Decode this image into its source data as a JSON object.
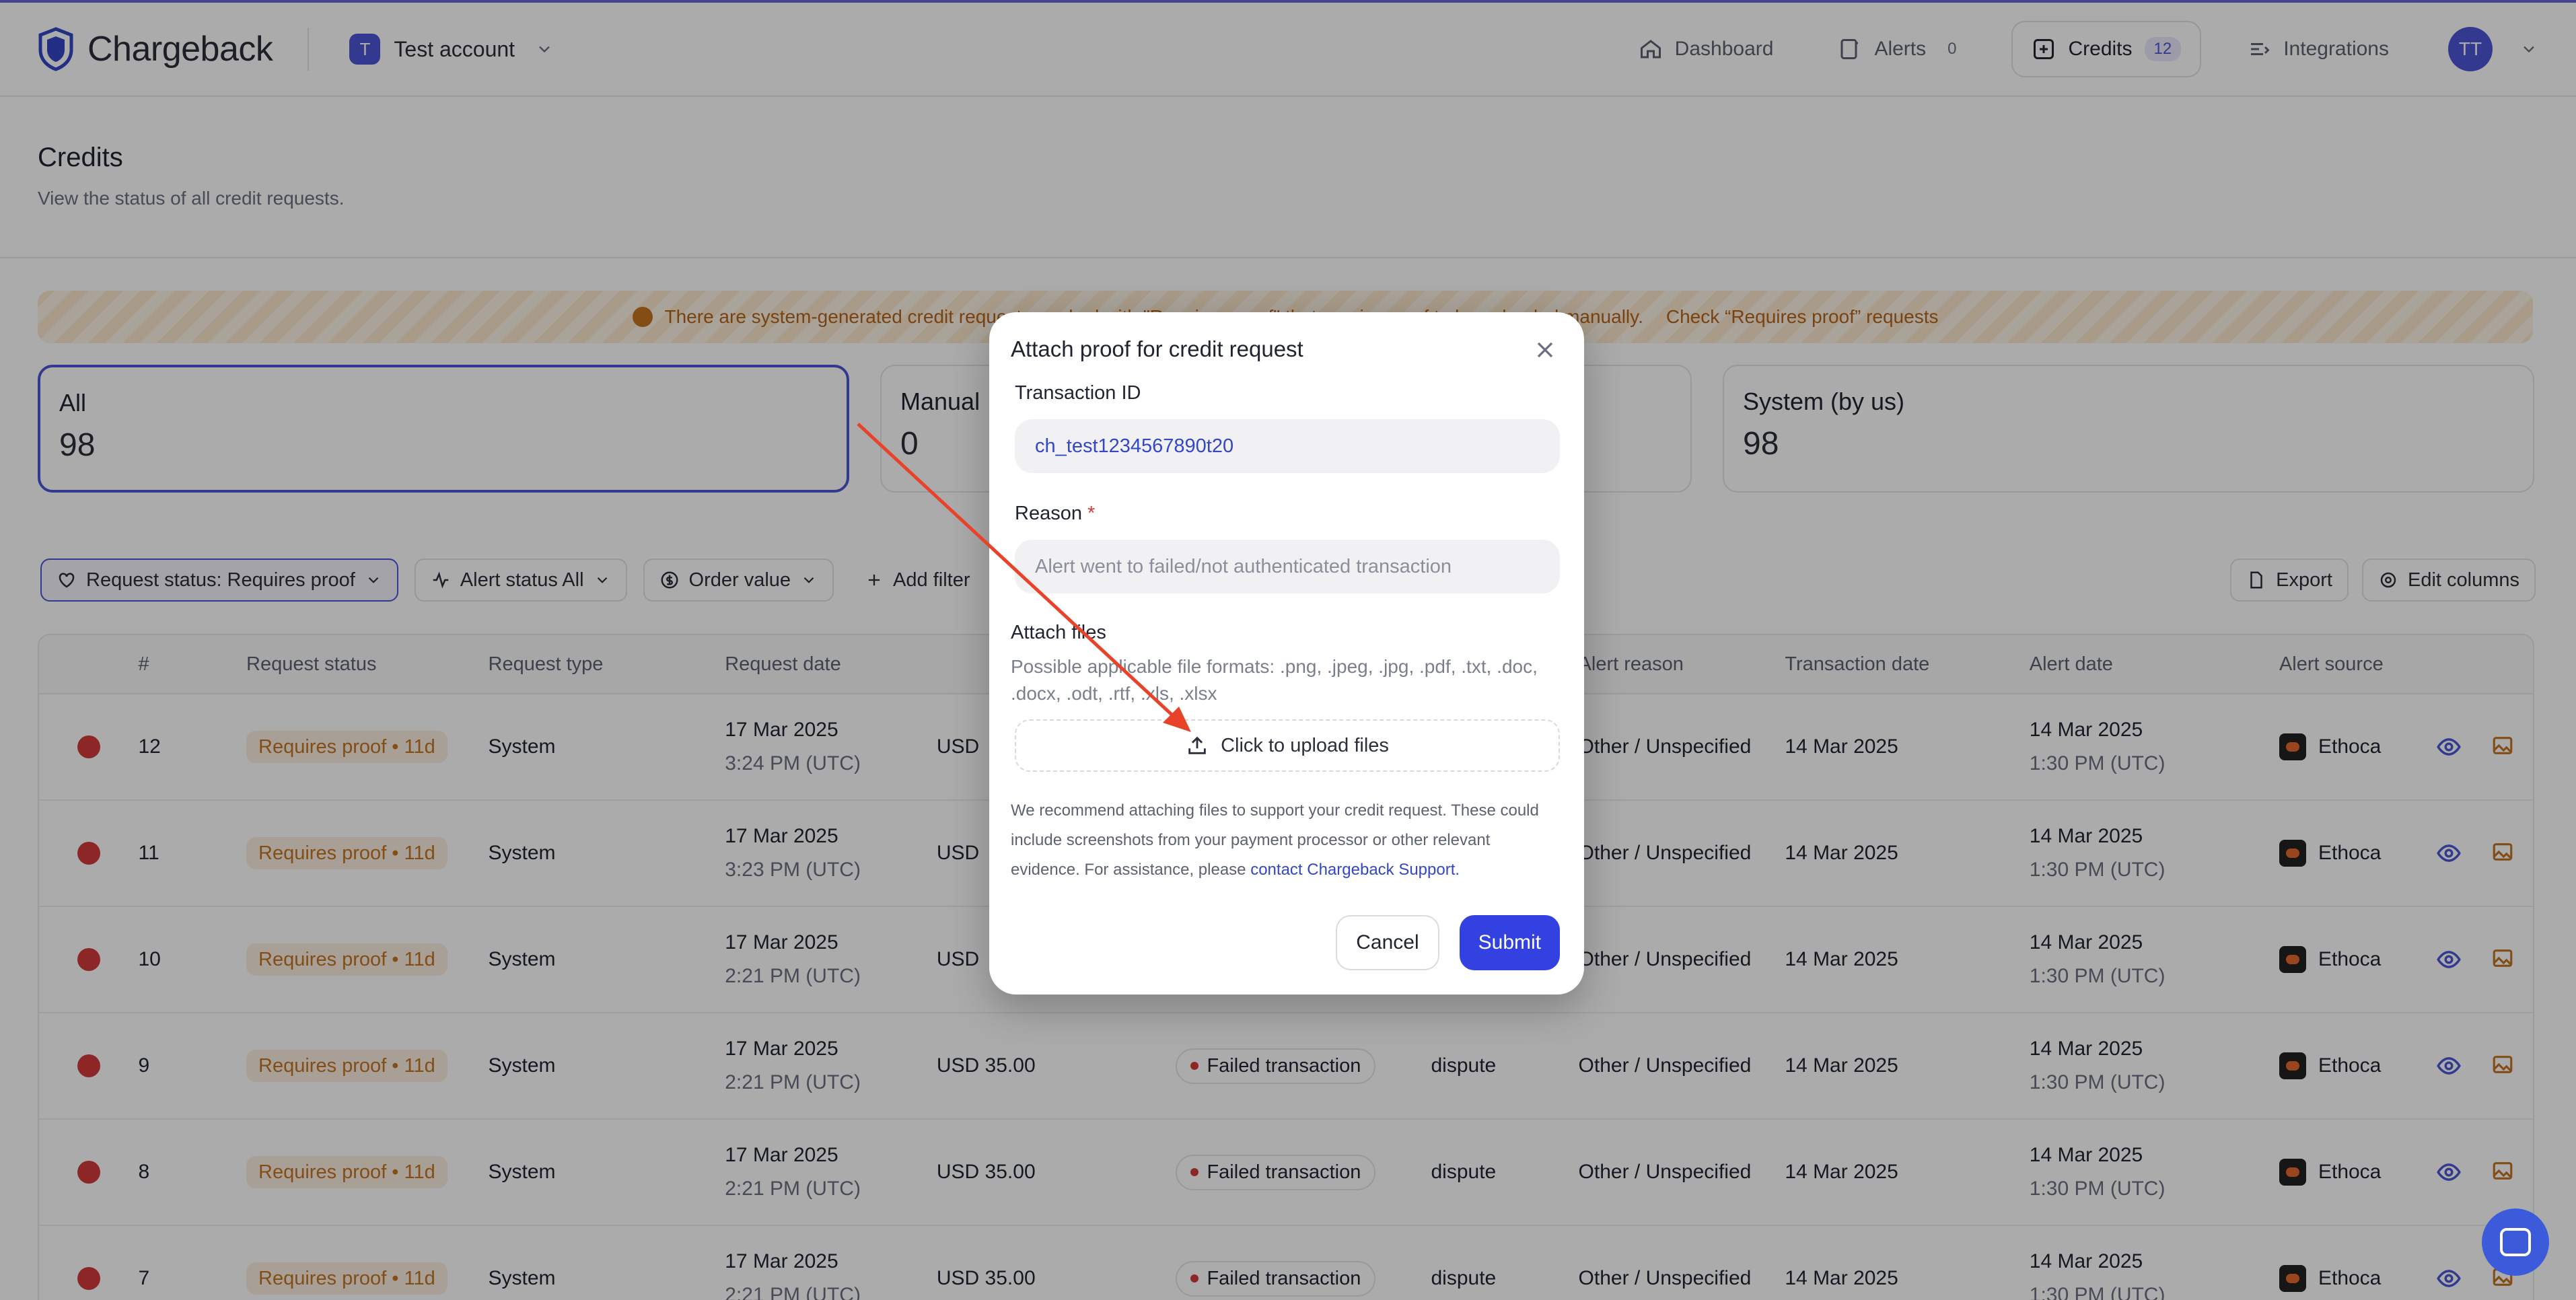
{
  "app": {
    "brand": "Chargeback",
    "account_initial": "T",
    "account_name": "Test account",
    "avatar_initials": "TT"
  },
  "nav": {
    "dashboard": "Dashboard",
    "alerts": "Alerts",
    "alerts_count": "0",
    "credits": "Credits",
    "credits_count": "12",
    "integrations": "Integrations"
  },
  "header": {
    "title": "Credits",
    "subtitle": "View the status of all credit requests."
  },
  "banner": {
    "text": "There are system-generated credit requests marked with \"Requires proof\" that require proof to be uploaded manually.",
    "link": "Check “Requires proof” requests"
  },
  "cards": [
    {
      "label": "All",
      "value": "98"
    },
    {
      "label": "Manual",
      "value": "0"
    },
    {
      "label": "System (by us)",
      "value": "98"
    }
  ],
  "filters": {
    "request_status": "Request status: Requires proof",
    "alert_status": "Alert status All",
    "order_value": "Order value",
    "add_filter": "Add filter",
    "export": "Export",
    "edit_columns": "Edit columns"
  },
  "table": {
    "headers": {
      "num": "#",
      "request_status": "Request status",
      "request_type": "Request type",
      "request_date": "Request date",
      "alert_reason": "Alert reason",
      "transaction_date": "Transaction date",
      "alert_date": "Alert date",
      "alert_source": "Alert source"
    },
    "rows": [
      {
        "num": "12",
        "status": "Requires proof • 11d",
        "type": "System",
        "date": "17 Mar 2025",
        "time": "3:24 PM (UTC)",
        "amount": "USD",
        "alert_status": "",
        "kind": "",
        "reason": "Other / Unspecified",
        "tx_date": "14 Mar 2025",
        "alert_date": "14 Mar 2025",
        "alert_time": "1:30 PM (UTC)",
        "source": "Ethoca"
      },
      {
        "num": "11",
        "status": "Requires proof • 11d",
        "type": "System",
        "date": "17 Mar 2025",
        "time": "3:23 PM (UTC)",
        "amount": "USD",
        "alert_status": "",
        "kind": "",
        "reason": "Other / Unspecified",
        "tx_date": "14 Mar 2025",
        "alert_date": "14 Mar 2025",
        "alert_time": "1:30 PM (UTC)",
        "source": "Ethoca"
      },
      {
        "num": "10",
        "status": "Requires proof • 11d",
        "type": "System",
        "date": "17 Mar 2025",
        "time": "2:21 PM (UTC)",
        "amount": "USD",
        "alert_status": "",
        "kind": "",
        "reason": "Other / Unspecified",
        "tx_date": "14 Mar 2025",
        "alert_date": "14 Mar 2025",
        "alert_time": "1:30 PM (UTC)",
        "source": "Ethoca"
      },
      {
        "num": "9",
        "status": "Requires proof • 11d",
        "type": "System",
        "date": "17 Mar 2025",
        "time": "2:21 PM (UTC)",
        "amount": "USD 35.00",
        "alert_status": "Failed transaction",
        "kind": "dispute",
        "reason": "Other / Unspecified",
        "tx_date": "14 Mar 2025",
        "alert_date": "14 Mar 2025",
        "alert_time": "1:30 PM (UTC)",
        "source": "Ethoca"
      },
      {
        "num": "8",
        "status": "Requires proof • 11d",
        "type": "System",
        "date": "17 Mar 2025",
        "time": "2:21 PM (UTC)",
        "amount": "USD 35.00",
        "alert_status": "Failed transaction",
        "kind": "dispute",
        "reason": "Other / Unspecified",
        "tx_date": "14 Mar 2025",
        "alert_date": "14 Mar 2025",
        "alert_time": "1:30 PM (UTC)",
        "source": "Ethoca"
      },
      {
        "num": "7",
        "status": "Requires proof • 11d",
        "type": "System",
        "date": "17 Mar 2025",
        "time": "2:21 PM (UTC)",
        "amount": "USD 35.00",
        "alert_status": "Failed transaction",
        "kind": "dispute",
        "reason": "Other / Unspecified",
        "tx_date": "14 Mar 2025",
        "alert_date": "14 Mar 2025",
        "alert_time": "1:30 PM (UTC)",
        "source": "Ethoca"
      }
    ]
  },
  "modal": {
    "title": "Attach proof for credit request",
    "transaction_label": "Transaction ID",
    "transaction_value": "ch_test1234567890t20",
    "reason_label": "Reason",
    "reason_required": "*",
    "reason_placeholder": "Alert went to failed/not authenticated transaction",
    "attach_title": "Attach files",
    "formats": "Possible applicable file formats: .png, .jpeg, .jpg, .pdf, .txt, .doc, .docx, .odt, .rtf, .xls, .xlsx",
    "upload_label": "Click to upload files",
    "note": "We recommend attaching files to support your credit request. These could include screenshots from your payment processor or other relevant evidence. For assistance, please",
    "note_link": "contact Chargeback Support.",
    "cancel": "Cancel",
    "submit": "Submit"
  },
  "colors": {
    "accent": "#3341e0",
    "warning": "#c47422",
    "annotation_arrow": "#e8432a"
  }
}
